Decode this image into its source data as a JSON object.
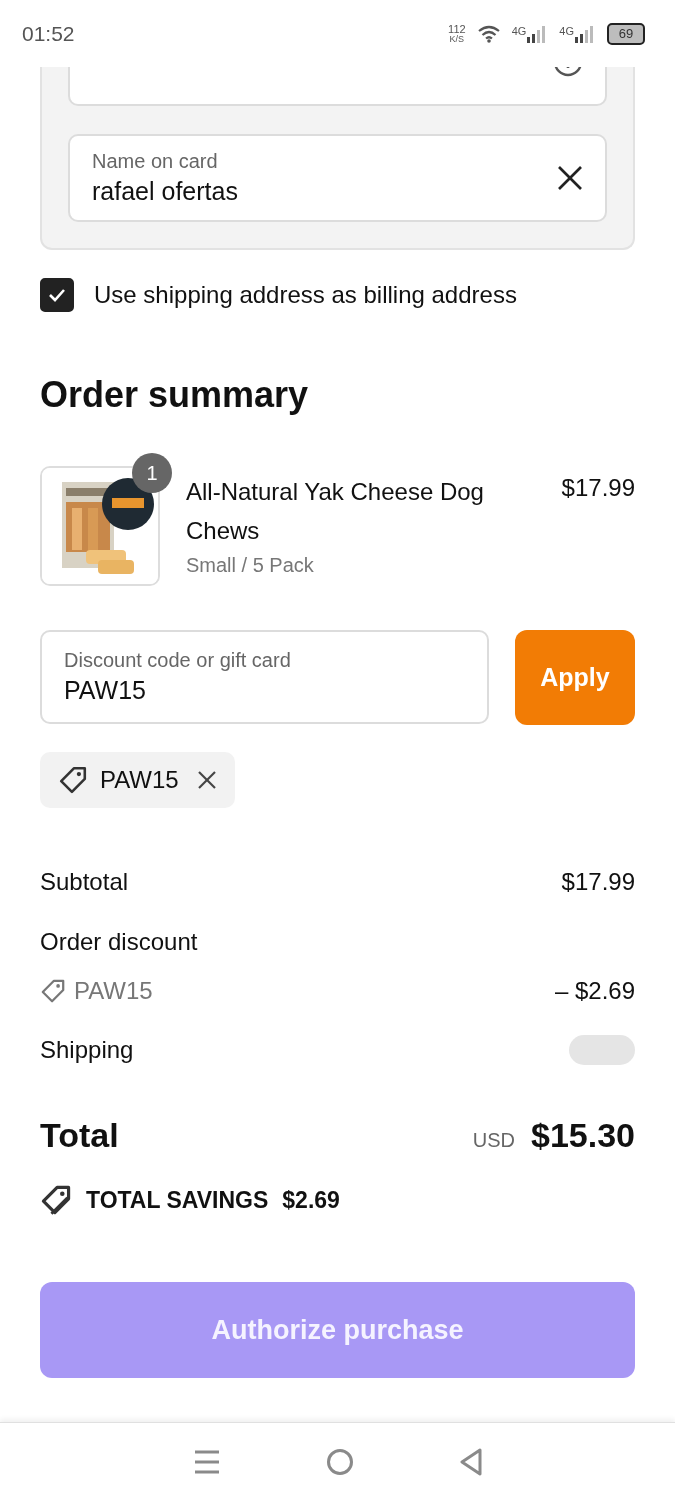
{
  "status_bar": {
    "time": "01:52",
    "net_speed": "112",
    "net_unit": "K/S",
    "signal_1": "4G",
    "signal_2": "4G",
    "battery": "69"
  },
  "card_fields": [
    {
      "kind": "empty"
    },
    {
      "kind": "filled",
      "label": "Name on card",
      "value": "rafael ofertas"
    }
  ],
  "billing_checkbox": {
    "label": "Use shipping address as billing address",
    "checked": true
  },
  "order_summary": {
    "title": "Order summary",
    "item": {
      "quantity": "1",
      "name": "All-Natural Yak Cheese Dog Chews",
      "variant": "Small / 5 Pack",
      "price": "$17.99"
    },
    "discount_field": {
      "label": "Discount code or gift card",
      "value": "PAW15"
    },
    "apply_button": "Apply",
    "applied_codes": [
      {
        "code": "PAW15"
      }
    ],
    "subtotal": {
      "label": "Subtotal",
      "amount": "$17.99"
    },
    "order_discount": {
      "label": "Order discount",
      "code": "PAW15",
      "amount": "– $2.69"
    },
    "shipping": {
      "label": "Shipping",
      "loading": true
    },
    "total": {
      "label": "Total",
      "currency": "USD",
      "amount": "$15.30"
    },
    "savings": {
      "label": "TOTAL SAVINGS",
      "amount": "$2.69"
    }
  },
  "authorize_button": {
    "label": "Authorize purchase",
    "disabled": true
  }
}
